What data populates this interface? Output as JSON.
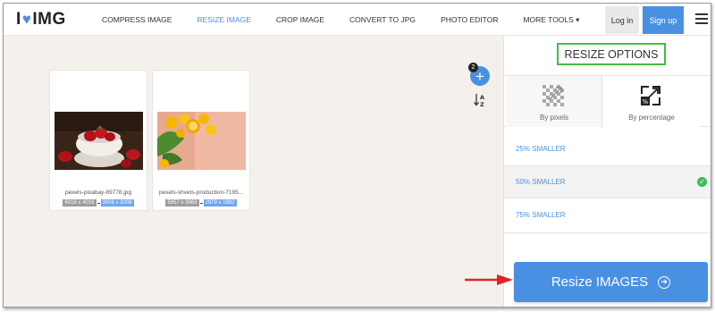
{
  "header": {
    "logo_left": "I",
    "logo_right": "IMG",
    "nav": [
      {
        "label": "COMPRESS IMAGE",
        "active": false
      },
      {
        "label": "RESIZE IMAGE",
        "active": true
      },
      {
        "label": "CROP IMAGE",
        "active": false
      },
      {
        "label": "CONVERT TO JPG",
        "active": false
      },
      {
        "label": "PHOTO EDITOR",
        "active": false
      },
      {
        "label": "MORE TOOLS ▾",
        "active": false
      }
    ],
    "login_label": "Log in",
    "signup_label": "Sign up"
  },
  "workspace": {
    "image_count": "2",
    "files": [
      {
        "name": "pexels-pixabay-89778.jpg",
        "orig_dims": "6016 x 4016",
        "new_dims": "3008 x 2008"
      },
      {
        "name": "pexels-shvets-production-7195...",
        "orig_dims": "5957 x 3963",
        "new_dims": "2979 x 1982"
      }
    ]
  },
  "sidebar": {
    "title": "RESIZE OPTIONS",
    "modes": [
      {
        "label": "By pixels",
        "selected": false
      },
      {
        "label": "By percentage",
        "selected": true
      }
    ],
    "options": [
      {
        "label": "25% SMALLER",
        "selected": false
      },
      {
        "label": "50% SMALLER",
        "selected": true
      },
      {
        "label": "75% SMALLER",
        "selected": false
      }
    ],
    "action_label": "Resize IMAGES"
  },
  "colors": {
    "accent": "#4a90e2",
    "check": "#3dba5e",
    "highlight_border": "#3fbf3f",
    "pointer": "#e02424"
  }
}
